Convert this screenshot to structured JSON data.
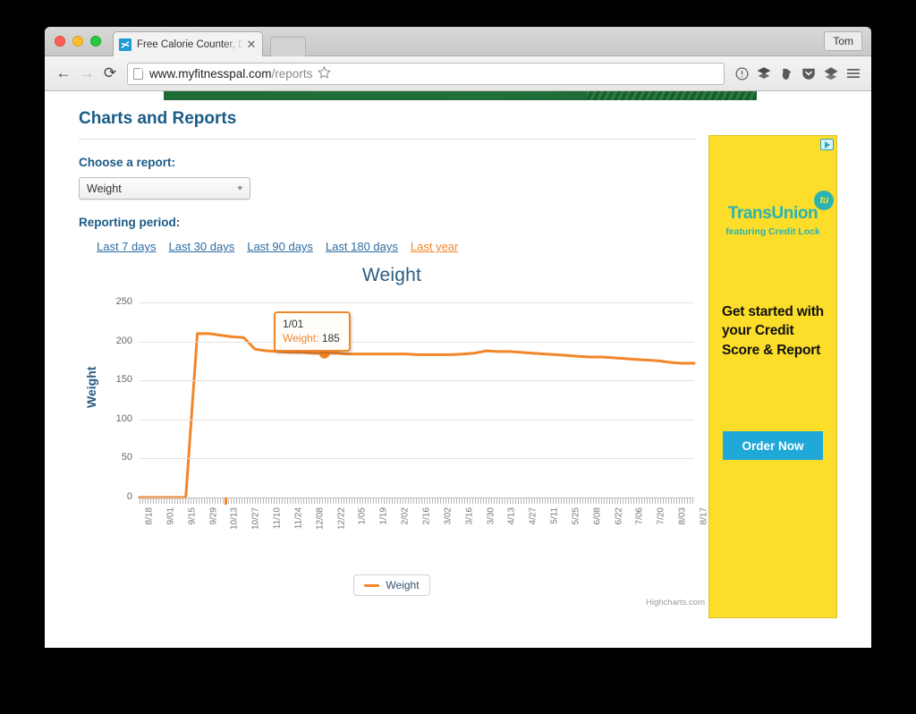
{
  "browser": {
    "tab": {
      "title": "Free Calorie Counter, Diet a",
      "close_label": "✕",
      "favicon_name": "myfitnesspal-favicon"
    },
    "profile_label": "Tom",
    "nav": {
      "back": "←",
      "forward": "→",
      "reload": "⟳"
    },
    "url": {
      "host": "www.myfitnesspal.com",
      "path": "/reports",
      "full": "www.myfitnesspal.com/reports"
    },
    "toolbar_icons": [
      "bookmark-star-icon",
      "info-circle-icon",
      "layers-icon",
      "evernote-elephant-icon",
      "pocket-shield-icon",
      "diamond-layers-icon",
      "hamburger-menu-icon"
    ]
  },
  "page": {
    "title": "Charts and Reports",
    "choose_report_label": "Choose a report:",
    "report_select": {
      "value": "Weight",
      "caret": "▾"
    },
    "reporting_period_label": "Reporting period:",
    "period_links": [
      {
        "label": "Last 7 days",
        "active": false
      },
      {
        "label": "Last 30 days",
        "active": false
      },
      {
        "label": "Last 90 days",
        "active": false
      },
      {
        "label": "Last 180 days",
        "active": false
      },
      {
        "label": "Last year",
        "active": true
      }
    ]
  },
  "chart_data": {
    "type": "line",
    "title": "Weight",
    "xlabel": "",
    "ylabel": "Weight",
    "ylim": [
      0,
      250
    ],
    "yticks": [
      0,
      50,
      100,
      150,
      200,
      250
    ],
    "grid": true,
    "legend_position": "bottom",
    "credit": "Highcharts.com",
    "series": [
      {
        "name": "Weight",
        "color": "#f2862b",
        "x": [
          "8/18",
          "9/01",
          "9/15",
          "9/29",
          "10/13",
          "10/20",
          "10/27",
          "11/03",
          "11/10",
          "11/17",
          "11/24",
          "12/01",
          "12/08",
          "12/15",
          "12/22",
          "12/29",
          "1/01",
          "1/12",
          "1/19",
          "1/26",
          "2/02",
          "2/09",
          "2/16",
          "2/23",
          "3/02",
          "3/09",
          "3/16",
          "3/23",
          "3/30",
          "4/06",
          "4/13",
          "4/20",
          "4/27",
          "5/04",
          "5/11",
          "5/18",
          "5/25",
          "6/01",
          "6/08",
          "6/15",
          "6/22",
          "6/29",
          "7/06",
          "7/13",
          "7/20",
          "7/27",
          "8/03",
          "8/10",
          "8/17"
        ],
        "values": [
          0,
          0,
          0,
          0,
          0,
          210,
          210,
          208,
          206,
          205,
          190,
          188,
          187,
          186,
          186,
          185,
          185,
          185,
          184,
          184,
          184,
          184,
          184,
          184,
          183,
          183,
          183,
          183,
          184,
          185,
          188,
          187,
          187,
          186,
          185,
          184,
          183,
          182,
          181,
          180,
          180,
          179,
          178,
          177,
          176,
          175,
          173,
          172,
          172
        ]
      }
    ],
    "xticks": [
      "8/18",
      "9/01",
      "9/15",
      "9/29",
      "10/13",
      "10/27",
      "11/10",
      "11/24",
      "12/08",
      "12/22",
      "1/05",
      "1/19",
      "2/02",
      "2/16",
      "3/02",
      "3/16",
      "3/30",
      "4/13",
      "4/27",
      "5/11",
      "5/25",
      "6/08",
      "6/22",
      "7/06",
      "7/20",
      "8/03",
      "8/17"
    ],
    "legend": [
      {
        "label": "Weight",
        "color": "#f2862b"
      }
    ],
    "tooltip": {
      "date": "1/01",
      "series_label": "Weight:",
      "value": "185"
    }
  },
  "ad": {
    "choices_icon": "ad-choices-icon",
    "brand": "TransUnion",
    "brand_badge": "tu",
    "tagline": "featuring Credit Lock",
    "headline": "Get started with your Credit Score & Report",
    "cta_label": "Order Now",
    "background_color": "#fbdd2a",
    "brand_color": "#2bb3b3",
    "cta_color": "#1fa8d8"
  }
}
